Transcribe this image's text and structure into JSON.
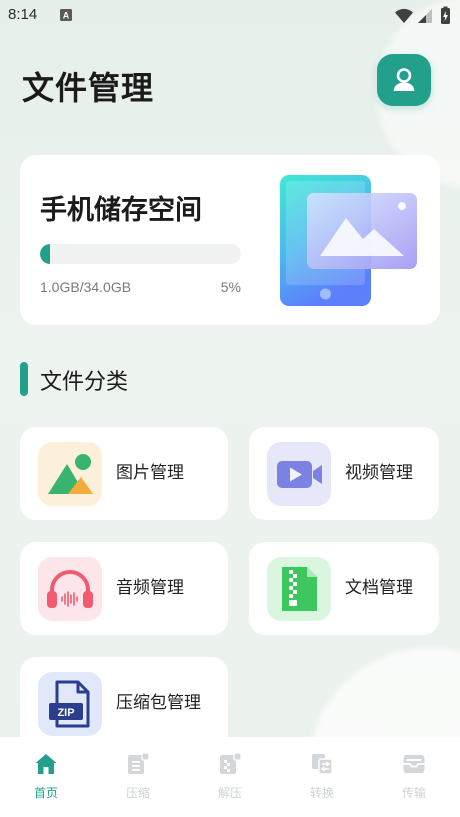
{
  "status_bar": {
    "time": "8:14",
    "notification_badge": "A",
    "icons": [
      "wifi-icon",
      "signal-icon",
      "battery-charging-icon"
    ]
  },
  "header": {
    "title": "文件管理",
    "avatar_icon": "user-icon"
  },
  "storage": {
    "title": "手机储存空间",
    "used_label": "1.0GB/34.0GB",
    "percent_label": "5%",
    "progress_percent": 5,
    "illustration_icon": "phone-image-icon"
  },
  "section": {
    "title": "文件分类"
  },
  "categories": [
    {
      "label": "图片管理",
      "icon": "image-icon",
      "icon_bg": "#fdf0db"
    },
    {
      "label": "视频管理",
      "icon": "video-icon",
      "icon_bg": "#e6e8fa"
    },
    {
      "label": "音频管理",
      "icon": "headphones-icon",
      "icon_bg": "#fde6ea"
    },
    {
      "label": "文档管理",
      "icon": "document-icon",
      "icon_bg": "#daf6df"
    },
    {
      "label": "压缩包管理",
      "icon": "zip-file-icon",
      "icon_bg": "#e1e8f9",
      "badge": "ZIP"
    }
  ],
  "nav": {
    "items": [
      {
        "label": "首页",
        "icon": "home-icon",
        "active": true
      },
      {
        "label": "压缩",
        "icon": "compress-icon",
        "active": false
      },
      {
        "label": "解压",
        "icon": "decompress-icon",
        "active": false
      },
      {
        "label": "转换",
        "icon": "convert-icon",
        "active": false
      },
      {
        "label": "传输",
        "icon": "transfer-icon",
        "active": false
      }
    ]
  },
  "colors": {
    "accent": "#22a08c",
    "inactive_nav": "#cfd3d6",
    "background": "#ebf1ed"
  }
}
